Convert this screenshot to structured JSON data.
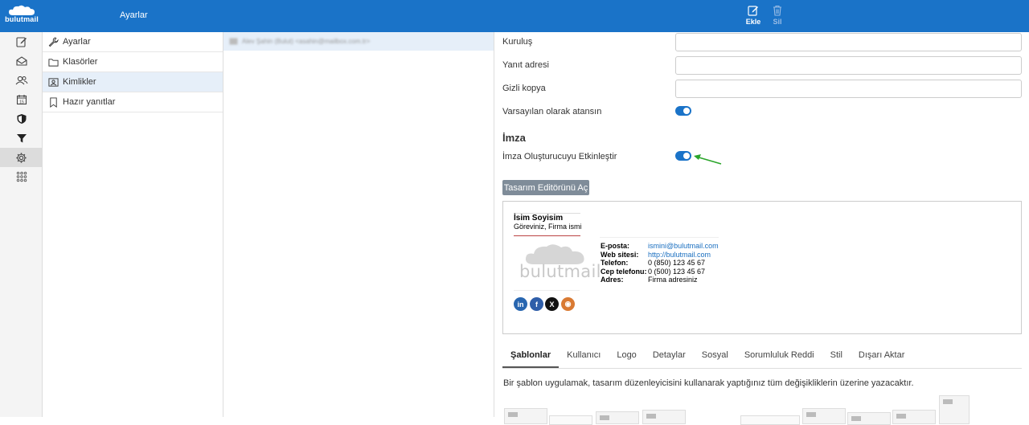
{
  "topbar": {
    "logo_text": "bulutmail",
    "title": "Ayarlar",
    "add_label": "Ekle",
    "delete_label": "Sil"
  },
  "rail": [
    {
      "icon": "compose-icon"
    },
    {
      "icon": "mail-icon"
    },
    {
      "icon": "contacts-icon"
    },
    {
      "icon": "calendar-icon"
    },
    {
      "icon": "shield-icon"
    },
    {
      "icon": "filter-icon"
    },
    {
      "icon": "gear-icon",
      "active": true
    },
    {
      "icon": "apps-icon"
    }
  ],
  "nav": {
    "items": [
      {
        "label": "Ayarlar",
        "icon": "wrench-icon"
      },
      {
        "label": "Klasörler",
        "icon": "folder-icon"
      },
      {
        "label": "Kimlikler",
        "icon": "id-card-icon",
        "selected": true
      },
      {
        "label": "Hazır yanıtlar",
        "icon": "bookmark-icon"
      }
    ]
  },
  "identity_list": {
    "row": "Alev Şahin (Bulut) <asahin@mailbox.com.tr>"
  },
  "form": {
    "organization_label": "Kuruluş",
    "reply_to_label": "Yanıt adresi",
    "bcc_label": "Gizli kopya",
    "default_label": "Varsayılan olarak atansın",
    "default_value": true,
    "signature_heading": "İmza",
    "sig_gen_label": "İmza Oluşturucuyu Etkinleştir",
    "sig_gen_value": true,
    "design_button": "Tasarım Editörünü Aç"
  },
  "signature": {
    "name": "İsim Soyisim",
    "title": "Göreviniz, Firma ismi",
    "logo_text": "bulutmail",
    "rows": [
      {
        "key": "E-posta:",
        "value": "ismini@bulutmail.com",
        "link": true
      },
      {
        "key": "Web sitesi:",
        "value": "http://bulutmail.com",
        "link": true
      },
      {
        "key": "Telefon:",
        "value": "0 (850) 123 45 67",
        "link": false
      },
      {
        "key": "Cep telefonu:",
        "value": "0 (500) 123 45 67",
        "link": false
      },
      {
        "key": "Adres:",
        "value": "Firma adresiniz",
        "link": false
      }
    ],
    "social": [
      {
        "icon": "linkedin-icon",
        "glyph": "in",
        "color": "#2866b0"
      },
      {
        "icon": "facebook-icon",
        "glyph": "f",
        "color": "#2f5ea9"
      },
      {
        "icon": "x-icon",
        "glyph": "X",
        "color": "#111111"
      },
      {
        "icon": "instagram-icon",
        "glyph": "◉",
        "color": "#d97a33"
      }
    ]
  },
  "editor_tabs": [
    {
      "label": "Şablonlar",
      "active": true
    },
    {
      "label": "Kullanıcı"
    },
    {
      "label": "Logo"
    },
    {
      "label": "Detaylar"
    },
    {
      "label": "Sosyal"
    },
    {
      "label": "Sorumluluk Reddi"
    },
    {
      "label": "Stil"
    },
    {
      "label": "Dışarı Aktar"
    }
  ],
  "template_note": "Bir şablon uygulamak, tasarım düzenleyicisini kullanarak yaptığınız tüm değişikliklerin üzerine yazacaktır.",
  "colors": {
    "brand": "#1a73c8",
    "toggle": "#1a73c8",
    "arrow": "#2aa52a"
  }
}
